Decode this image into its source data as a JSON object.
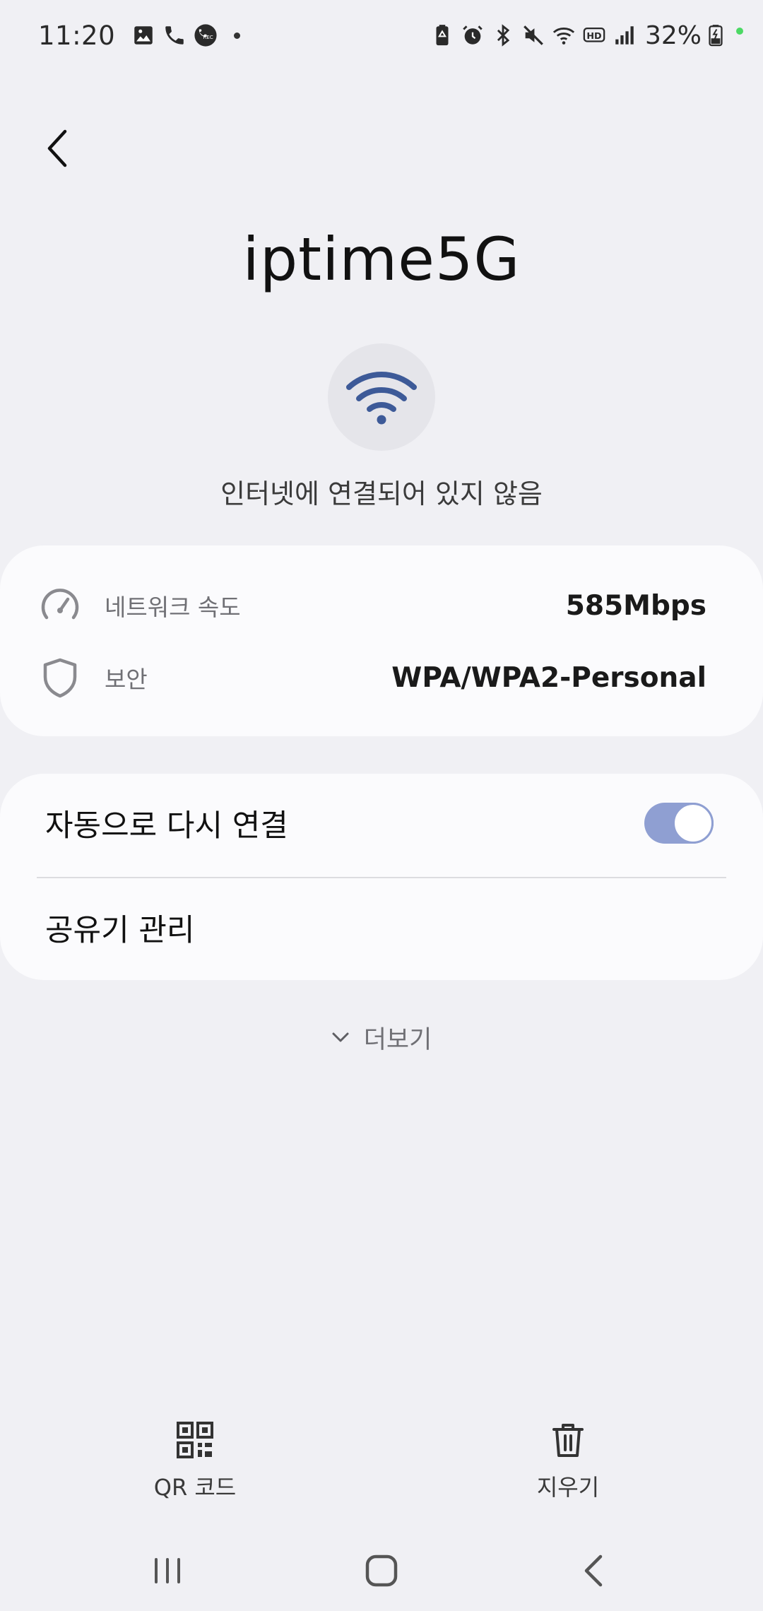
{
  "status_bar": {
    "time": "11:20",
    "battery": "32%",
    "left_icons": [
      "gallery-icon",
      "phone-icon",
      "call-recording-icon"
    ],
    "right_icons": [
      "battery-saver-icon",
      "alarm-icon",
      "bluetooth-icon",
      "mute-icon",
      "wifi-icon",
      "hd-voice-icon",
      "signal-icon",
      "battery-charging-icon"
    ]
  },
  "header": {
    "back_icon": "chevron-left-icon"
  },
  "network": {
    "name": "iptime5G",
    "status": "인터넷에 연결되어 있지 않음",
    "wifi_color": "#3d5a98"
  },
  "info": {
    "speed_label": "네트워크 속도",
    "speed_value": "585Mbps",
    "security_label": "보안",
    "security_value": "WPA/WPA2-Personal"
  },
  "settings": {
    "auto_reconnect_label": "자동으로 다시 연결",
    "auto_reconnect_on": true,
    "router_manage_label": "공유기 관리",
    "toggle_color": "#8f9fd2"
  },
  "more": {
    "label": "더보기"
  },
  "actions": {
    "qr_label": "QR 코드",
    "delete_label": "지우기"
  },
  "nav": {
    "icons": [
      "recent-apps-icon",
      "home-icon",
      "back-icon"
    ]
  }
}
